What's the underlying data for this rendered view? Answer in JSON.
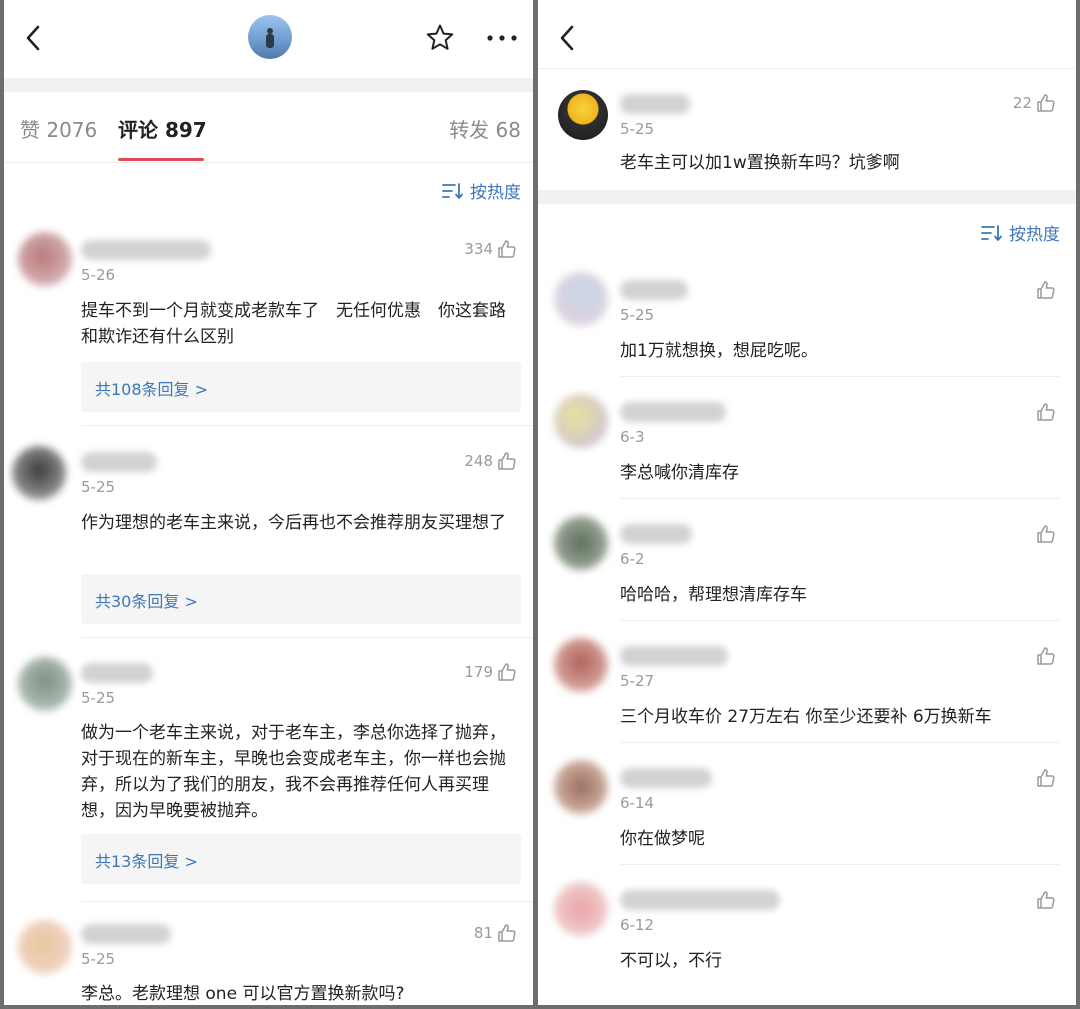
{
  "left": {
    "tabs": [
      {
        "label": "赞",
        "count": "2076"
      },
      {
        "label": "评论",
        "count": "897"
      },
      {
        "label": "转发",
        "count": "68"
      }
    ],
    "sort_label": "按热度",
    "comments": [
      {
        "date": "5-26",
        "likes": "334",
        "text": "提车不到一个月就变成老款车了　无任何优惠　你这套路和欺诈还有什么区别",
        "replies": "共108条回复 >"
      },
      {
        "date": "5-25",
        "likes": "248",
        "text": "作为理想的老车主来说，今后再也不会推荐朋友买理想了",
        "replies": "共30条回复 >"
      },
      {
        "date": "5-25",
        "likes": "179",
        "text": "做为一个老车主来说，对于老车主，李总你选择了抛弃，对于现在的新车主，早晚也会变成老车主，你一样也会抛弃，所以为了我们的朋友，我不会再推荐任何人再买理想，因为早晚要被抛弃。",
        "replies": "共13条回复 >"
      },
      {
        "date": "5-25",
        "likes": "81",
        "text": "李总。老款理想 one 可以官方置换新款吗?"
      }
    ]
  },
  "right": {
    "main_comment": {
      "date": "5-25",
      "likes": "22",
      "text": "老车主可以加1w置换新车吗？坑爹啊"
    },
    "sort_label": "按热度",
    "replies": [
      {
        "date": "5-25",
        "text": "加1万就想换，想屁吃呢。"
      },
      {
        "date": "6-3",
        "text": "李总喊你清库存"
      },
      {
        "date": "6-2",
        "text": "哈哈哈，帮理想清库存车"
      },
      {
        "date": "5-27",
        "text": "三个月收车价 27万左右 你至少还要补 6万换新车"
      },
      {
        "date": "6-14",
        "text": "你在做梦呢"
      },
      {
        "date": "6-12",
        "text": "不可以，不行"
      }
    ]
  },
  "icons": [
    "back-icon",
    "star-icon",
    "more-icon",
    "thumbs-up-icon",
    "sort-icon"
  ],
  "colors": {
    "accent_link": "#3e77b8",
    "tab_underline": "#e24a58",
    "muted_text": "#9a9a9a"
  }
}
